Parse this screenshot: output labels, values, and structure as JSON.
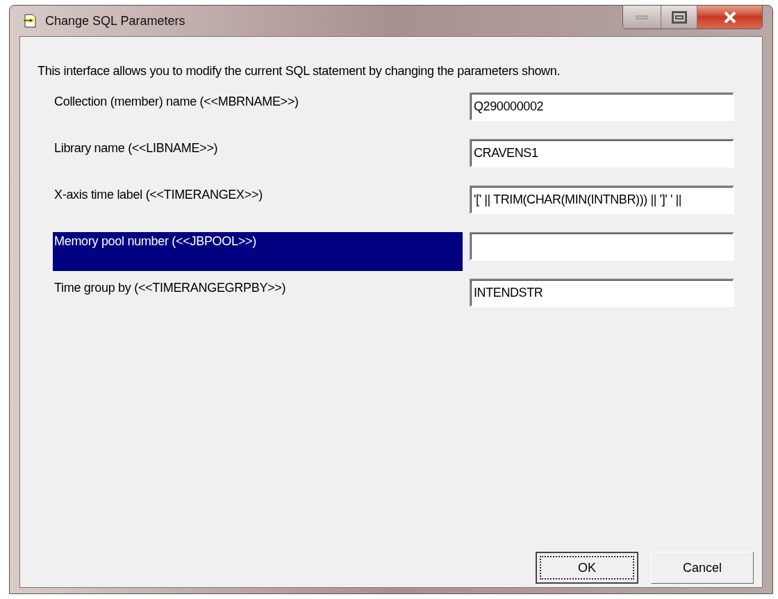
{
  "window": {
    "title": "Change SQL Parameters"
  },
  "intro": "This interface allows you to modify the current SQL statement by changing the parameters shown.",
  "parameters": [
    {
      "label": "Collection (member) name (<<MBRNAME>>)",
      "value": "Q290000002",
      "selected": false
    },
    {
      "label": "Library name (<<LIBNAME>>)",
      "value": "CRAVENS1",
      "selected": false
    },
    {
      "label": "X-axis time label (<<TIMERANGEX>>)",
      "value": "'[' || TRIM(CHAR(MIN(INTNBR))) || ']' ' ||",
      "selected": false
    },
    {
      "label": "Memory pool number (<<JBPOOL>>)",
      "selected": true
    },
    {
      "label": "Time group by (<<TIMERANGEGRPBY>>)",
      "value": "INTENDSTR",
      "selected": false
    }
  ],
  "buttons": [
    {
      "label": "OK",
      "default": true
    },
    {
      "label": "Cancel",
      "default": false
    }
  ]
}
